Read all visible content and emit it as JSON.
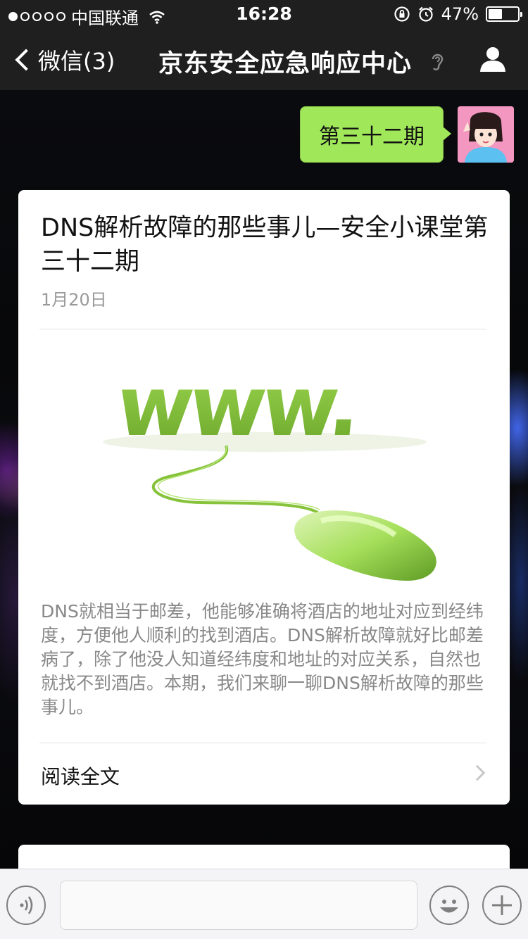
{
  "status_bar": {
    "signal_dots": 5,
    "signal_filled": 1,
    "carrier": "中国联通",
    "time": "16:28",
    "battery_percent": "47%",
    "battery_level": 0.47
  },
  "nav": {
    "back_label": "微信(3)",
    "title": "京东安全应急响应中心"
  },
  "chat": {
    "sent_message": "第三十二期"
  },
  "article": {
    "title": "DNS解析故障的那些事儿—安全小课堂第三十二期",
    "date": "1月20日",
    "image_text": "www.",
    "summary": "DNS就相当于邮差，他能够准确将酒店的地址对应到经纬度，方便他人顺利的找到酒店。DNS解析故障就好比邮差病了，除了他没人知道经纬度和地址的对应关系，自然也就找不到酒店。本期，我们来聊一聊DNS解析故障的那些事儿。",
    "read_more": "阅读全文"
  },
  "input_bar": {
    "text_value": ""
  },
  "colors": {
    "bar_bg": "#1f1f1f",
    "bubble": "#a0e75a",
    "accent_green": "#8dc63f"
  }
}
